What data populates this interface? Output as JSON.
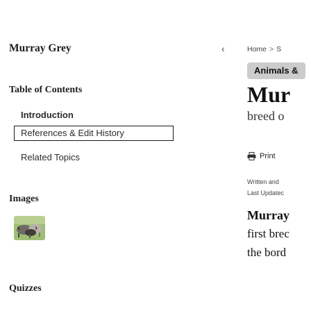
{
  "sidebar": {
    "article_title": "Murray Grey",
    "toc_heading": "Table of Contents",
    "toc_items": [
      {
        "label": "Introduction"
      },
      {
        "label": "References & Edit History"
      },
      {
        "label": "Related Topics"
      }
    ],
    "images_heading": "Images",
    "quizzes_heading": "Quizzes"
  },
  "article": {
    "breadcrumb": [
      "Home",
      "S"
    ],
    "category": "Animals &",
    "title": "Mur",
    "subtitle": "breed o",
    "print_label": "Print",
    "written_by": "Written and",
    "last_updated": "Last Updatec",
    "body_lines": [
      "Murray",
      "first brec",
      "the bord"
    ]
  },
  "icons": {
    "collapse": "chevron-left-icon",
    "print": "printer-icon",
    "image_prev": "chevron-left-icon",
    "image_next": "chevron-right-icon"
  }
}
